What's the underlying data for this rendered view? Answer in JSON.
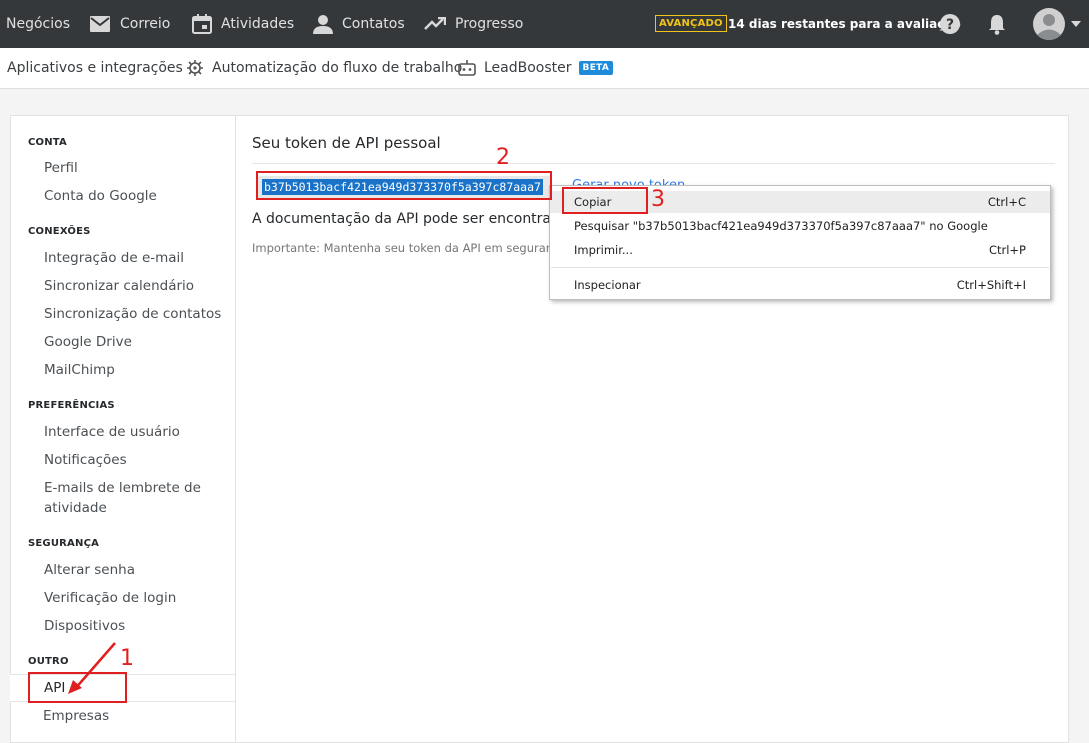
{
  "topnav": {
    "items": [
      {
        "label": "Negócios",
        "icon": "none"
      },
      {
        "label": "Correio",
        "icon": "mail-icon"
      },
      {
        "label": "Atividades",
        "icon": "calendar-icon"
      },
      {
        "label": "Contatos",
        "icon": "person-icon"
      },
      {
        "label": "Progresso",
        "icon": "trending-icon"
      }
    ],
    "badge": "AVANÇADO",
    "trial_text": "14 dias restantes para a avaliação",
    "help_icon": "help-icon",
    "bell_icon": "bell-icon",
    "avatar_icon": "avatar-icon"
  },
  "subnav": {
    "items": [
      {
        "label": "Aplicativos e integrações"
      },
      {
        "label": "Automatização do fluxo de trabalho",
        "icon": "robot-icon"
      },
      {
        "label": "LeadBooster",
        "icon": "bot-icon"
      }
    ],
    "beta": "BETA"
  },
  "sidebar": {
    "sections": [
      {
        "heading": "CONTA",
        "items": [
          "Perfil",
          "Conta do Google"
        ]
      },
      {
        "heading": "CONEXÕES",
        "items": [
          "Integração de e-mail",
          "Sincronizar calendário",
          "Sincronização de contatos",
          "Google Drive",
          "MailChimp"
        ]
      },
      {
        "heading": "PREFERÊNCIAS",
        "items": [
          "Interface de usuário",
          "Notificações",
          "E-mails de lembrete de atividade"
        ]
      },
      {
        "heading": "SEGURANÇA",
        "items": [
          "Alterar senha",
          "Verificação de login",
          "Dispositivos"
        ]
      },
      {
        "heading": "OUTRO",
        "items": [
          "API",
          "Empresas"
        ]
      }
    ],
    "active": "API"
  },
  "main": {
    "title": "Seu token de API pessoal",
    "token": "b37b5013bacf421ea949d373370f5a397c87aaa7",
    "new_token_link": "Gerar novo token",
    "doc_text": "A documentação da API pode ser encontrada",
    "important": "Importante: Mantenha seu token da API em segurança."
  },
  "context_menu": {
    "items": [
      {
        "label": "Copiar",
        "shortcut": "Ctrl+C",
        "highlighted": true
      },
      {
        "label": "Pesquisar \"b37b5013bacf421ea949d373370f5a397c87aaa7\" no Google",
        "shortcut": ""
      },
      {
        "label": "Imprimir...",
        "shortcut": "Ctrl+P"
      },
      {
        "label": "Inspecionar",
        "shortcut": "Ctrl+Shift+I"
      }
    ]
  },
  "annotations": {
    "step1": "1",
    "step2": "2",
    "step3": "3",
    "color": "#e02020"
  },
  "colors": {
    "topbar": "#35383b",
    "accent_badge": "#f0c419",
    "beta": "#1e8cdb",
    "selection": "#1a73c9",
    "link": "#317ae2"
  }
}
